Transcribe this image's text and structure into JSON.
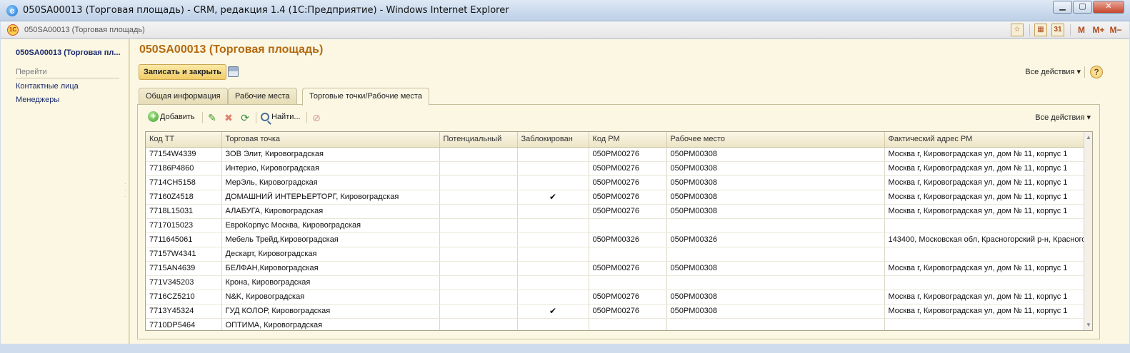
{
  "window": {
    "title": "050SA00013 (Торговая площадь) - CRM, редакция 1.4 (1С:Предприятие) - Windows Internet Explorer",
    "ie_icon": "e",
    "minimize": "▁",
    "maximize": "▢",
    "close": "✕"
  },
  "appbar": {
    "title": "050SA00013 (Торговая площадь)",
    "logo_text": "1С",
    "tools": [
      "star-icon",
      "calendar-icon",
      "calendar-31-icon",
      "M",
      "M+",
      "M−"
    ]
  },
  "left_panel": {
    "current": "050SA00013 (Торговая пл...",
    "go_label": "Перейти",
    "links": [
      "Контактные лица",
      "Менеджеры"
    ]
  },
  "form": {
    "title": "050SA00013 (Торговая площадь)",
    "save_close": "Записать и закрыть",
    "all_actions": "Все действия ▾",
    "help": "?",
    "tabs": [
      "Общая информация",
      "Рабочие места",
      "Торговые точки/Рабочие места"
    ],
    "active_tab": 2
  },
  "toolbar": {
    "add": "Добавить",
    "find": "Найти...",
    "all_actions": "Все действия ▾"
  },
  "grid": {
    "columns": [
      "Код ТТ",
      "Торговая точка",
      "Потенциальный",
      "Заблокирован",
      "Код РМ",
      "Рабочее место",
      "Фактический адрес РМ"
    ],
    "rows": [
      [
        "77154W4339",
        "ЗОВ Элит, Кировоградская",
        "",
        "",
        "050PM00276",
        "050PM00308",
        "Москва г, Кировоградская ул, дом № 11, корпус 1"
      ],
      [
        "77186P4860",
        "Интерио, Кировоградская",
        "",
        "",
        "050PM00276",
        "050PM00308",
        "Москва г, Кировоградская ул, дом № 11, корпус 1"
      ],
      [
        "7714CH5158",
        "МерЭль, Кировоградская",
        "",
        "",
        "050PM00276",
        "050PM00308",
        "Москва г, Кировоградская ул, дом № 11, корпус 1"
      ],
      [
        "77160Z4518",
        "ДОМАШНИЙ ИНТЕРЬЕРТОРГ, Кировоградская",
        "",
        "✔",
        "050PM00276",
        "050PM00308",
        "Москва г, Кировоградская ул, дом № 11, корпус 1"
      ],
      [
        "7718L15031",
        "АЛАБУГА, Кировоградская",
        "",
        "",
        "050PM00276",
        "050PM00308",
        "Москва г, Кировоградская ул, дом № 11, корпус 1"
      ],
      [
        "7717015023",
        "ЕвроКорпус Москва, Кировоградская",
        "",
        "",
        "",
        "",
        ""
      ],
      [
        "7711645061",
        "Мебель Трейд,Кировоградская",
        "",
        "",
        "050PM00326",
        "050PM00326",
        "143400, Московская обл, Красногорский р-н, Красногор"
      ],
      [
        "77157W4341",
        "Дескарт, Кировоградская",
        "",
        "",
        "",
        "",
        ""
      ],
      [
        "7715AN4639",
        "БЕЛФАН,Кировоградская",
        "",
        "",
        "050PM00276",
        "050PM00308",
        "Москва г, Кировоградская ул, дом № 11, корпус 1"
      ],
      [
        "771V345203",
        "Крона, Кировоградская",
        "",
        "",
        "",
        "",
        ""
      ],
      [
        "7716CZ5210",
        "N&K, Кировоградская",
        "",
        "",
        "050PM00276",
        "050PM00308",
        "Москва г, Кировоградская ул, дом № 11, корпус 1"
      ],
      [
        "7713Y45324",
        "ГУД КОЛОР, Кировоградская",
        "",
        "✔",
        "050PM00276",
        "050PM00308",
        "Москва г, Кировоградская ул, дом № 11, корпус 1"
      ],
      [
        "7710DP5464",
        "ОПТИМА, Кировоградская",
        "",
        "",
        "",
        "",
        ""
      ]
    ]
  },
  "colors": {
    "accent_title": "#b46a10",
    "panel_bg": "#fbf7e3",
    "link": "#1b2a6e"
  }
}
